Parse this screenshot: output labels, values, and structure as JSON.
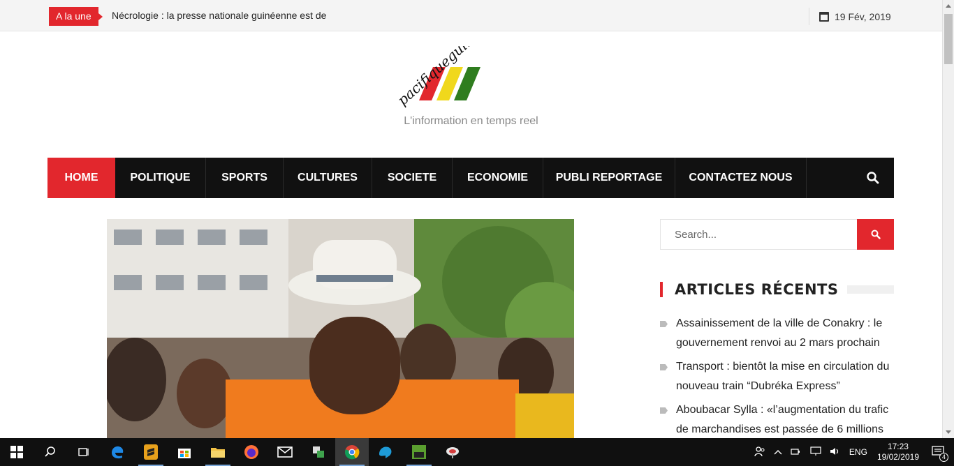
{
  "topbar": {
    "badge": "A la une",
    "ticker": "Nécrologie : la presse nationale guinéenne est de",
    "date": "19 Fév, 2019"
  },
  "site": {
    "logo_text": "pacifiqueguinee.com",
    "tagline": "L'information en temps reel"
  },
  "nav": {
    "items": [
      "HOME",
      "POLITIQUE",
      "SPORTS",
      "CULTURES",
      "SOCIETE",
      "ECONOMIE",
      "PUBLI REPORTAGE",
      "CONTACTEZ NOUS"
    ]
  },
  "sidebar": {
    "search_placeholder": "Search...",
    "recent_title": "ARTICLES RÉCENTS",
    "recent": [
      "Assainissement de la ville de Conakry : le gouvernement renvoi au 2 mars prochain",
      "Transport : bientôt la mise en circulation du nouveau train “Dubréka Express”",
      "Aboubacar Sylla : «l’augmentation du trafic de marchandises est passée de 6 millions"
    ]
  },
  "taskbar": {
    "lang": "ENG",
    "time": "17:23",
    "date": "19/02/2019",
    "notifications": "4"
  },
  "colors": {
    "accent": "#e2272d",
    "nav_bg": "#111111"
  }
}
